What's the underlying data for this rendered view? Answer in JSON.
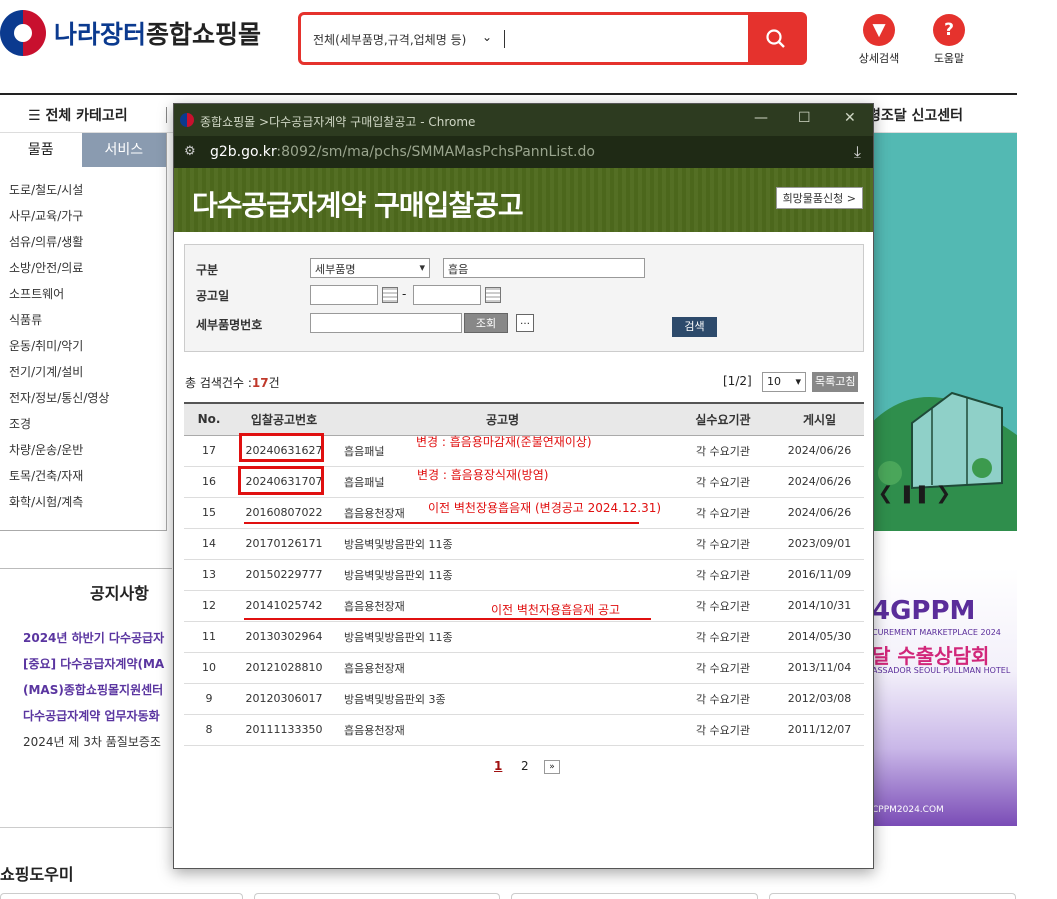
{
  "site": {
    "logo_a": "나라장터",
    "logo_b": "종합쇼핑몰",
    "search_category": "전체(세부품명,규격,업체명 등)",
    "detail_search": "상세검색",
    "help": "도움말",
    "all_category": "전체 카테고리",
    "report_center": "령조달 신고센터",
    "tabs": [
      "물품",
      "서비스"
    ],
    "categories": [
      "도로/철도/시설",
      "사무/교육/가구",
      "섬유/의류/생활",
      "소방/안전/의료",
      "소프트웨어",
      "식품류",
      "운동/취미/악기",
      "전기/기계/설비",
      "전자/정보/통신/영상",
      "조경",
      "차량/운송/운반",
      "토목/건축/자재",
      "화학/시험/계측"
    ],
    "notice_title": "공지사항",
    "notices": [
      "2024년 하반기 다수공급자",
      "[중요] 다수공급자계약(MA",
      "(MAS)종합쇼핑몰지원센터",
      "다수공급자계약 업무자동화",
      "2024년 제 3차 품질보증조"
    ],
    "shop_help": "쇼핑도우미",
    "banner2": {
      "big": "4GPPM",
      "sub": "CUREMENT MARKETPLACE 2024",
      "kr": "달 수출상담회",
      "hotel": "ASSADOR SEOUL PULLMAN HOTEL",
      "site": "CPPM2024.COM"
    }
  },
  "popup": {
    "title": "종합쇼핑몰 >다수공급자계약 구매입찰공고 - Chrome",
    "url_host": "g2b.go.kr",
    "url_path": ":8092/sm/ma/pchs/SMMAMasPchsPannList.do",
    "heading": "다수공급자계약 구매입찰공고",
    "wish_button": "희망물품신청 >",
    "form": {
      "label_category": "구분",
      "category_value": "세부품명",
      "keyword_value": "흡음",
      "label_date": "공고일",
      "date_sep": "-",
      "label_item_no": "세부품명번호",
      "lookup_button": "조회",
      "search_button": "검색"
    },
    "count_label": "총 검색건수 :",
    "count_value": "17",
    "count_unit": "건",
    "page_info": "[1/2]",
    "per_page": "10",
    "list_button": "목록고침",
    "columns": [
      "No.",
      "입찰공고번호",
      "공고명",
      "실수요기관",
      "게시일"
    ],
    "rows": [
      {
        "no": "17",
        "bid": "20240631627",
        "name": "흡음패널",
        "org": "각 수요기관",
        "date": "2024/06/26"
      },
      {
        "no": "16",
        "bid": "20240631707",
        "name": "흡음패널",
        "org": "각 수요기관",
        "date": "2024/06/26"
      },
      {
        "no": "15",
        "bid": "20160807022",
        "name": "흡음용천장재",
        "org": "각 수요기관",
        "date": "2024/06/26"
      },
      {
        "no": "14",
        "bid": "20170126171",
        "name": "방음벽및방음판외 11종",
        "org": "각 수요기관",
        "date": "2023/09/01"
      },
      {
        "no": "13",
        "bid": "20150229777",
        "name": "방음벽및방음판외 11종",
        "org": "각 수요기관",
        "date": "2016/11/09"
      },
      {
        "no": "12",
        "bid": "20141025742",
        "name": "흡음용천장재",
        "org": "각 수요기관",
        "date": "2014/10/31"
      },
      {
        "no": "11",
        "bid": "20130302964",
        "name": "방음벽및방음판외 11종",
        "org": "각 수요기관",
        "date": "2014/05/30"
      },
      {
        "no": "10",
        "bid": "20121028810",
        "name": "흡음용천장재",
        "org": "각 수요기관",
        "date": "2013/11/04"
      },
      {
        "no": "9",
        "bid": "20120306017",
        "name": "방음벽및방음판외 3종",
        "org": "각 수요기관",
        "date": "2012/03/08"
      },
      {
        "no": "8",
        "bid": "20111133350",
        "name": "흡음용천장재",
        "org": "각 수요기관",
        "date": "2011/12/07"
      }
    ],
    "annotations": [
      "변경 : 흡음용마감재(준불연재이상)",
      "변경 : 흡음용장식재(방염)",
      "이전  벽천장용흡음재 (변경공고 2024.12.31)",
      "이전 벽천자용흡음재 공고"
    ],
    "pages": [
      "1",
      "2"
    ]
  }
}
